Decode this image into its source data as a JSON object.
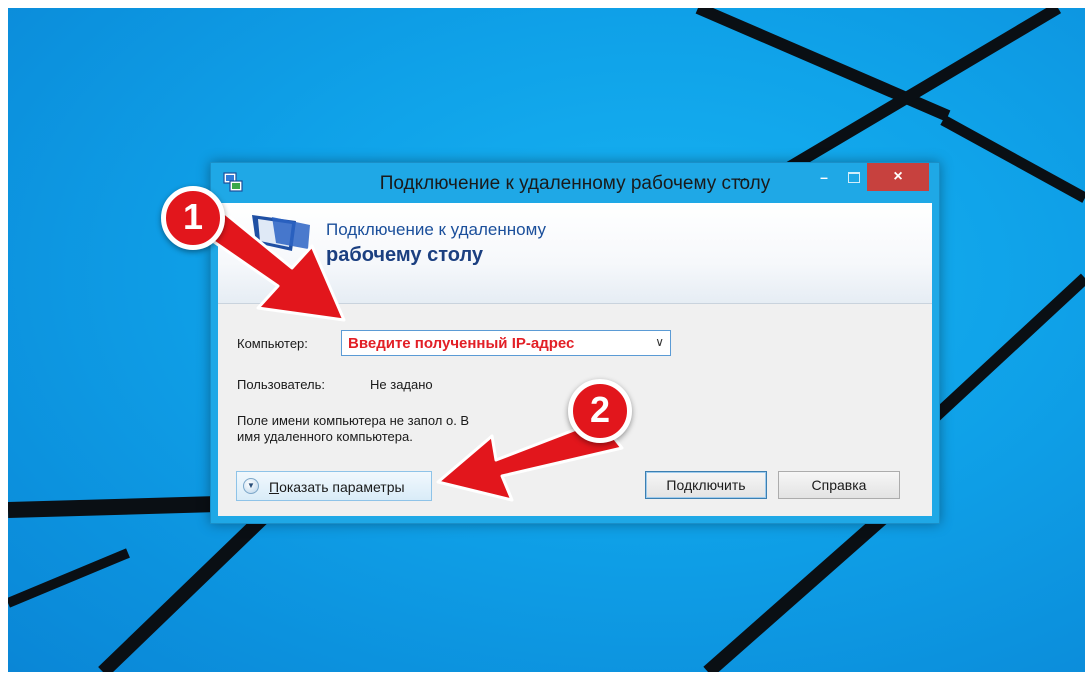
{
  "window": {
    "title": "Подключение к удаленному рабочему столу",
    "minimize_glyph": "–",
    "close_glyph": "×",
    "resize_glyph": "↔"
  },
  "banner": {
    "line1": "Подключение к удаленному",
    "line2": "рабочему столу"
  },
  "form": {
    "computer_label": "Компьютер:",
    "computer_value": "Введите полученный IP-адрес",
    "user_label": "Пользователь:",
    "user_value": "Не задано",
    "hint_line1": "Поле имени компьютера не запол  о. В",
    "hint_line2": "имя удаленного компьютера."
  },
  "buttons": {
    "show_options_accesskey": "П",
    "show_options_rest": "оказать параметры",
    "connect": "Подключить",
    "help": "Справка"
  },
  "annotations": {
    "badge_1": "1",
    "badge_2": "2"
  },
  "colors": {
    "desktop": "#0fa1e8",
    "window_frame": "#1fa8e6",
    "close_button": "#c7413e",
    "annotation_red": "#e2161c",
    "ip_text": "#e21f26"
  },
  "icons": [
    "remote-desktop-app-icon",
    "remote-desktop-banner-icon",
    "chevron-down-icon",
    "expand-options-icon",
    "resize-icon"
  ]
}
